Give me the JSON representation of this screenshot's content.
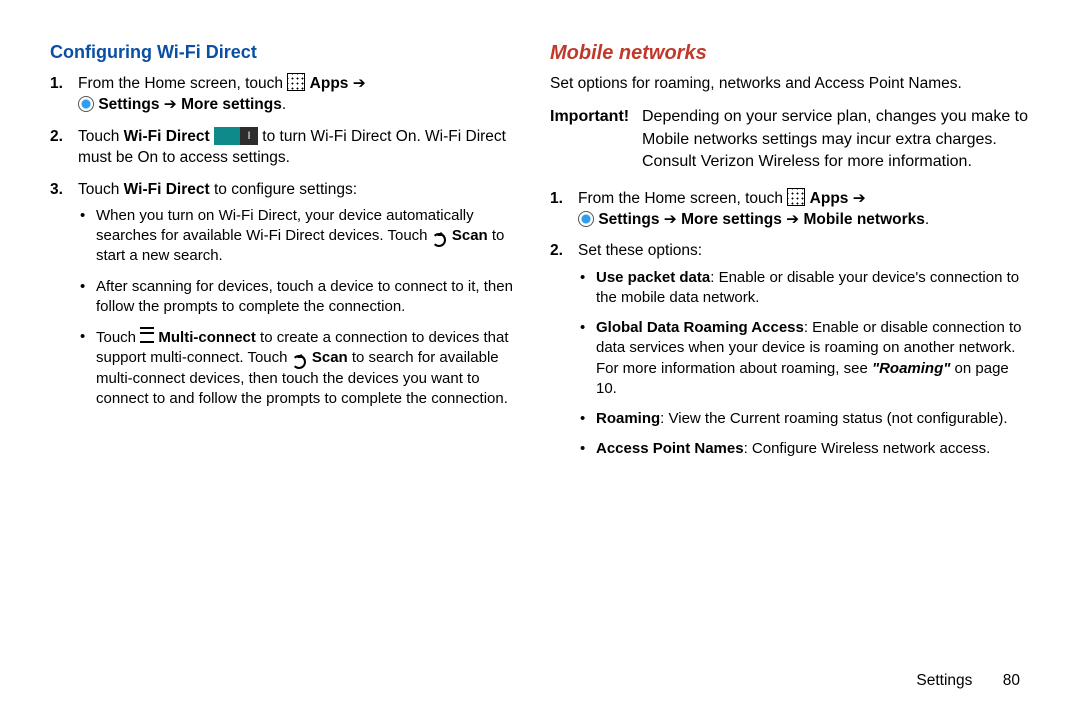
{
  "left": {
    "heading": "Configuring Wi-Fi Direct",
    "step1": {
      "n": "1.",
      "a": "From the Home screen, touch ",
      "apps": "Apps",
      "arrow": " ➔ ",
      "settings": "Settings",
      "arrow2": " ➔ ",
      "more": "More settings",
      "dot": "."
    },
    "step2": {
      "n": "2.",
      "a": "Touch ",
      "wfd": "Wi-Fi Direct",
      "b": " to turn Wi-Fi Direct On. Wi-Fi Direct must be On to access settings."
    },
    "step3": {
      "n": "3.",
      "a": "Touch ",
      "wfd": "Wi-Fi Direct",
      "b": " to configure settings:"
    },
    "b1": {
      "a": "When you turn on Wi-Fi Direct, your device automatically searches for available Wi-Fi Direct devices. Touch ",
      "scan": "Scan",
      "b": " to start a new search."
    },
    "b2": "After scanning for devices, touch a device to connect to it, then follow the prompts to complete the connection.",
    "b3": {
      "a": "Touch ",
      "mc": "Multi-connect",
      "b": " to create a connection to devices that support multi-connect. Touch ",
      "scan": "Scan",
      "c": " to search for available multi-connect devices, then touch the devices you want to connect to and follow the prompts to complete the connection."
    }
  },
  "right": {
    "heading": "Mobile networks",
    "intro": "Set options for roaming, networks and Access Point Names.",
    "important": {
      "lbl": "Important!",
      "txt": "Depending on your service plan, changes you make to Mobile networks settings may incur extra charges. Consult Verizon Wireless for more information."
    },
    "step1": {
      "n": "1.",
      "a": "From the Home screen, touch ",
      "apps": "Apps",
      "arrow": " ➔ ",
      "settings": "Settings",
      "arrow2": " ➔ ",
      "more": "More settings",
      "arrow3": " ➔ ",
      "mn": "Mobile networks",
      "dot": "."
    },
    "step2": {
      "n": "2.",
      "a": "Set these options:"
    },
    "o1": {
      "t": "Use packet data",
      "b": ": Enable or disable your device's connection to the mobile data network."
    },
    "o2": {
      "t": "Global Data Roaming Access",
      "b": ": Enable or disable connection to data services when your device is roaming on another network. For more information about roaming, see ",
      "q": "\"Roaming\"",
      "c": " on page 10."
    },
    "o3": {
      "t": "Roaming",
      "b": ": View the Current roaming status (not configurable)."
    },
    "o4": {
      "t": "Access Point Names",
      "b": ": Configure Wireless network access."
    }
  },
  "footer": {
    "section": "Settings",
    "page": "80"
  }
}
